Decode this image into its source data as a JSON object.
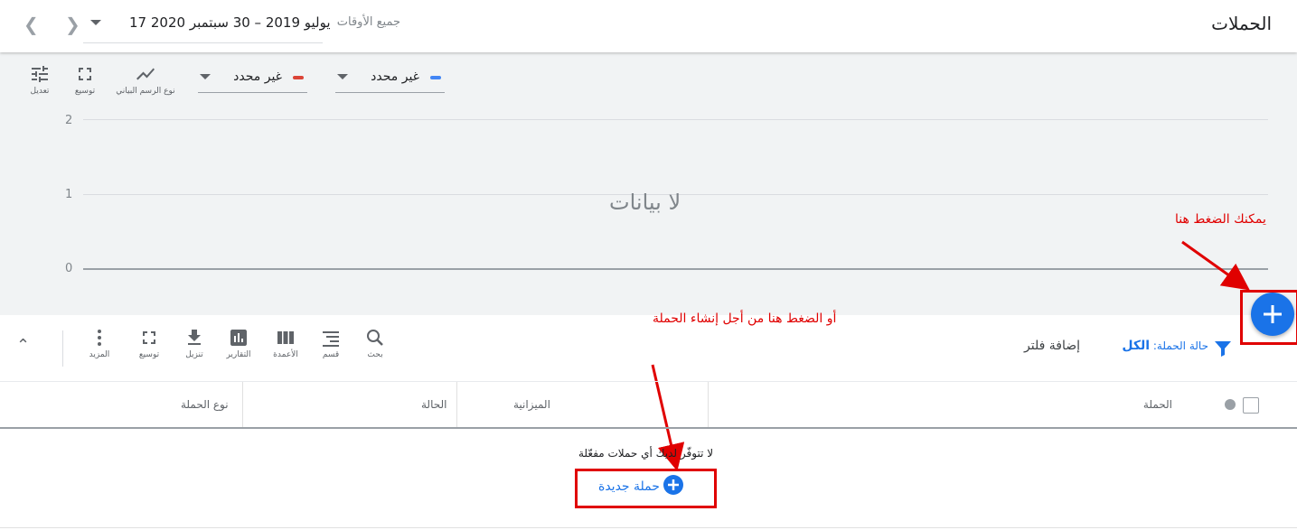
{
  "header": {
    "title": "الحملات",
    "all_times_label": "جميع الأوقات",
    "date_range": "17 يوليو 2019 – 30 سبتمبر 2020"
  },
  "chart_toolbar": {
    "adjust_label": "تعديل",
    "expand_label": "توسيع",
    "chart_type_label": "نوع الرسم البياني"
  },
  "metrics": [
    {
      "label": "غير محدد",
      "color": "#4285f4"
    },
    {
      "label": "غير محدد",
      "color": "#db4437"
    }
  ],
  "chart_data": {
    "type": "line",
    "y_ticks": [
      "2",
      "1",
      "0"
    ],
    "ylim": [
      0,
      2
    ],
    "series": [],
    "no_data_text": "لا بيانات"
  },
  "table_toolbar": {
    "search_label": "بحث",
    "segment_label": "قسم",
    "columns_label": "الأعمدة",
    "reports_label": "التقارير",
    "download_label": "تنزيل",
    "expand_label": "توسيع",
    "more_label": "المزيد"
  },
  "filter": {
    "status_label": "حالة الحملة:",
    "status_value": "الكل",
    "add_filter": "إضافة فلتر"
  },
  "table": {
    "columns": [
      "الحملة",
      "الميزانية",
      "الحالة",
      "نوع الحملة"
    ],
    "empty_message": "لا تتوفّر لديك أي حملات مفعّلة",
    "new_campaign_label": "حملة جديدة"
  },
  "annotations": {
    "click_here": "يمكنك الضغط هنا",
    "or_click_here": "أو الضغط هنا من أجل إنشاء الحملة",
    "color": "#e00000"
  }
}
